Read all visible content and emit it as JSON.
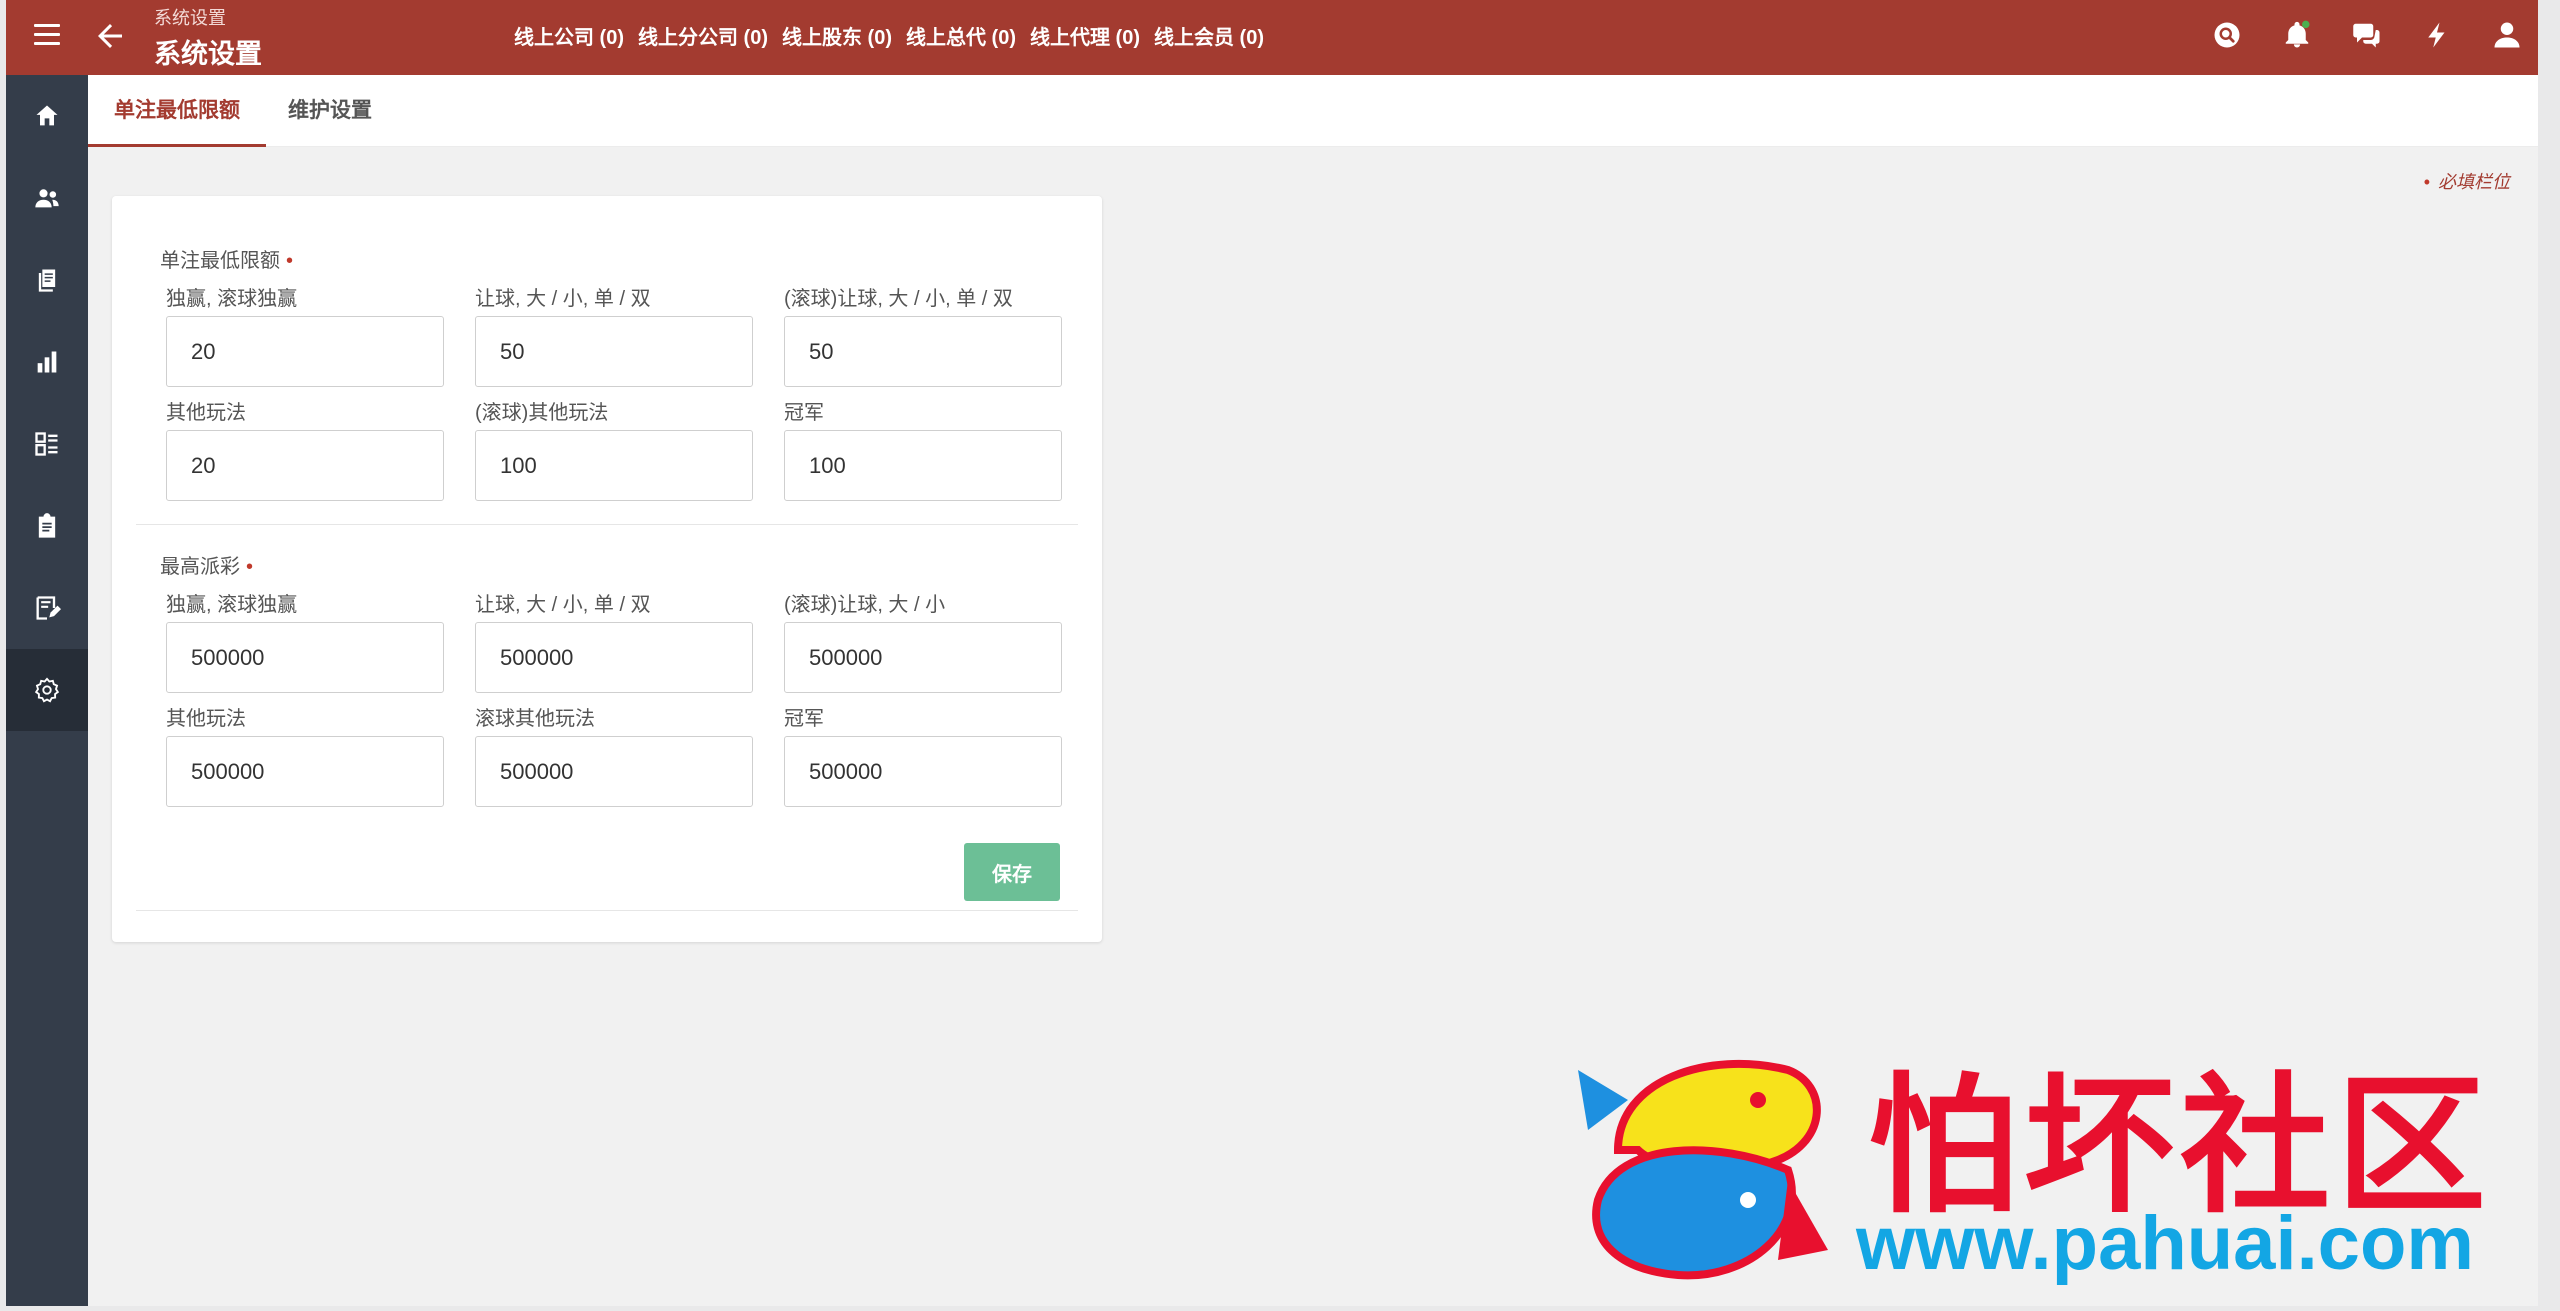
{
  "header": {
    "breadcrumb": "系统设置",
    "title": "系统设置",
    "nav": [
      "线上公司 (0)",
      "线上分公司 (0)",
      "线上股东 (0)",
      "线上总代 (0)",
      "线上代理 (0)",
      "线上会员 (0)"
    ],
    "icons": [
      "search-icon",
      "bell-icon",
      "chat-icon",
      "flash-icon",
      "user-icon"
    ],
    "notification_dot_color": "#4caf50"
  },
  "sidebar": {
    "items": [
      "home-icon",
      "users-icon",
      "documents-icon",
      "bar-chart-icon",
      "list-icon",
      "clipboard-icon",
      "edit-report-icon",
      "settings-icon"
    ],
    "active": "settings-icon"
  },
  "tabs": [
    {
      "label": "单注最低限额",
      "active": true
    },
    {
      "label": "维护设置",
      "active": false
    }
  ],
  "required_note": "必填栏位",
  "form": {
    "min_bet": {
      "title": "单注最低限额",
      "fields": [
        {
          "label": "独赢, 滚球独赢",
          "value": "20"
        },
        {
          "label": "让球, 大 / 小, 单 / 双",
          "value": "50"
        },
        {
          "label": "(滚球)让球, 大 / 小, 单 / 双",
          "value": "50"
        },
        {
          "label": "其他玩法",
          "value": "20"
        },
        {
          "label": "(滚球)其他玩法",
          "value": "100"
        },
        {
          "label": "冠军",
          "value": "100"
        }
      ]
    },
    "max_payout": {
      "title": "最高派彩",
      "fields": [
        {
          "label": "独赢, 滚球独赢",
          "value": "500000"
        },
        {
          "label": "让球, 大 / 小, 单 / 双",
          "value": "500000"
        },
        {
          "label": "(滚球)让球, 大 / 小",
          "value": "500000"
        },
        {
          "label": "其他玩法",
          "value": "500000"
        },
        {
          "label": "滚球其他玩法",
          "value": "500000"
        },
        {
          "label": "冠军",
          "value": "500000"
        }
      ]
    },
    "save_label": "保存"
  },
  "watermark": {
    "text": "怕坏社区",
    "url": "www.pahuai.com"
  },
  "colors": {
    "brand": "#a33b30",
    "sidebar": "#343d4a",
    "save_button": "#6cbf96"
  }
}
